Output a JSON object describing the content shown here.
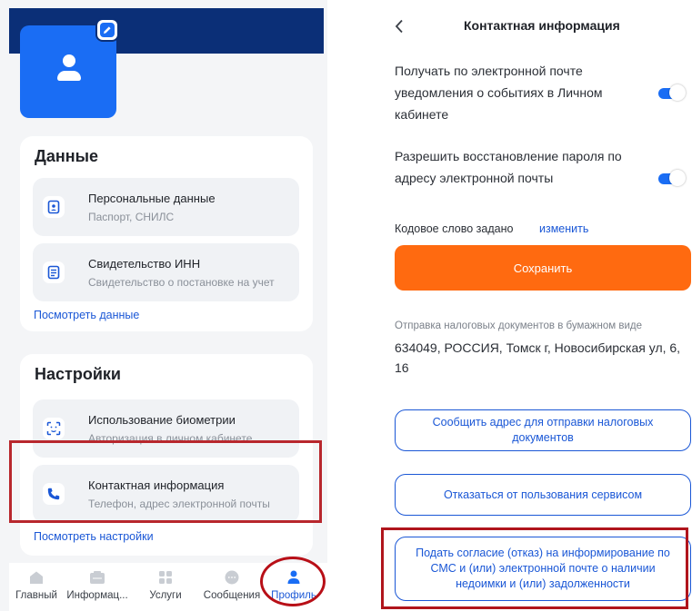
{
  "left": {
    "data_card": {
      "title": "Данные",
      "items": [
        {
          "title": "Персональные данные",
          "subtitle": "Паспорт, СНИЛС",
          "icon": "document-person-icon"
        },
        {
          "title": "Свидетельство ИНН",
          "subtitle": "Свидетельство о постановке на учет",
          "icon": "certificate-icon"
        }
      ],
      "link": "Посмотреть данные"
    },
    "settings_card": {
      "title": "Настройки",
      "items": [
        {
          "title": "Использование биометрии",
          "subtitle": "Авторизация в личном кабинете",
          "icon": "face-scan-icon"
        },
        {
          "title": "Контактная информация",
          "subtitle": "Телефон, адрес электронной почты",
          "icon": "phone-icon"
        }
      ],
      "link": "Посмотреть настройки"
    },
    "bottom_nav": [
      {
        "label": "Главный",
        "icon": "home-icon",
        "active": false
      },
      {
        "label": "Информац...",
        "icon": "info-icon",
        "active": false
      },
      {
        "label": "Услуги",
        "icon": "grid-icon",
        "active": false
      },
      {
        "label": "Сообщения",
        "icon": "message-icon",
        "active": false
      },
      {
        "label": "Профиль",
        "icon": "profile-icon",
        "active": true
      }
    ]
  },
  "right": {
    "title": "Контактная информация",
    "preferences": [
      {
        "text": "Получать по электронной почте уведомления о событиях в Личном кабинете",
        "enabled": true
      },
      {
        "text": "Разрешить восстановление пароля по адресу электронной почты",
        "enabled": true
      }
    ],
    "codeword_label": "Кодовое слово задано",
    "codeword_link": "изменить",
    "save_label": "Сохранить",
    "paper_label": "Отправка налоговых документов в бумажном виде",
    "paper_address": "634049, РОССИЯ, Томск г, Новосибирская ул, 6, 16",
    "buttons": [
      "Сообщить адрес для отправки налоговых документов",
      "Отказаться от пользования сервисом",
      "Подать согласие (отказ) на информирование по СМС и (или) электронной почте о наличии недоимки и (или) задолженности"
    ]
  },
  "colors": {
    "header": "#0b2f77",
    "accent": "#1a6df4",
    "save_button": "#ff6a10",
    "highlight": "#b8272d"
  }
}
